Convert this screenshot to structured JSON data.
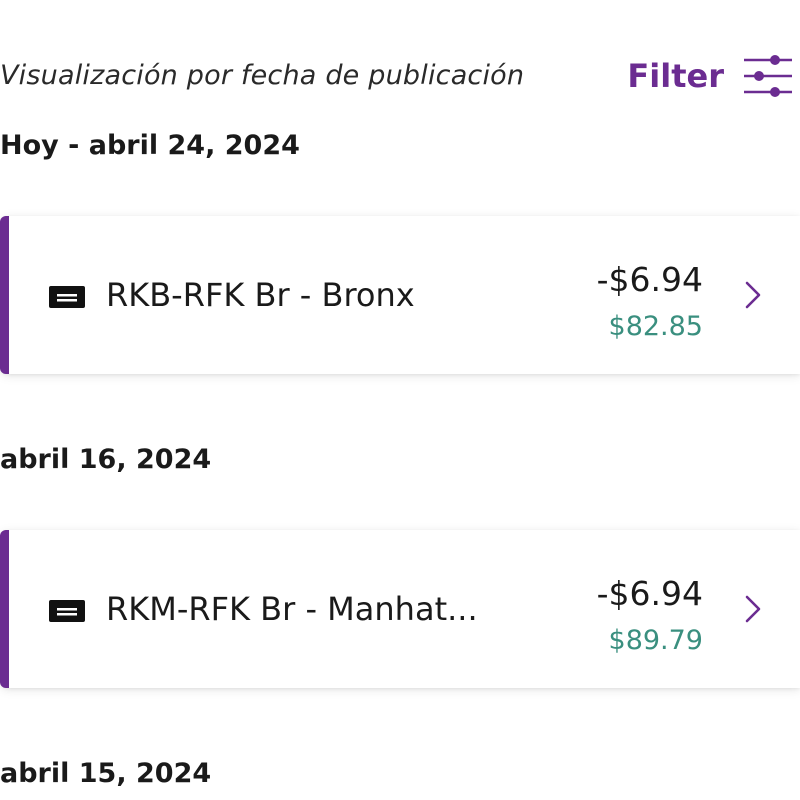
{
  "header": {
    "view_label": "Visualización por fecha de publicación",
    "filter_label": "Filter",
    "filter_icon": "sliders-icon",
    "accent_color": "#6b2c91"
  },
  "groups": [
    {
      "date": "Hoy - abril 24, 2024",
      "transactions": [
        {
          "icon": "card-icon",
          "title": "RKB-RFK Br - Bronx",
          "amount": "-$6.94",
          "balance": "$82.85"
        }
      ]
    },
    {
      "date": "abril 16, 2024",
      "transactions": [
        {
          "icon": "card-icon",
          "title": "RKM-RFK Br - Manhat...",
          "amount": "-$6.94",
          "balance": "$89.79"
        }
      ]
    },
    {
      "date": "abril 15, 2024",
      "transactions": []
    }
  ],
  "colors": {
    "balance": "#3a8f7f",
    "text": "#1a1a1a"
  }
}
